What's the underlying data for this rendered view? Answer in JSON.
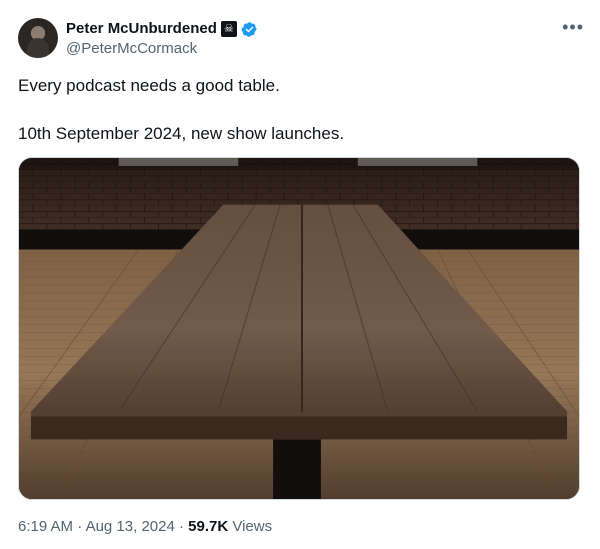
{
  "author": {
    "display_name": "Peter McUnburdened",
    "handle": "@PeterMcCormack",
    "flag_icon": "pirate-flag-icon",
    "verified_icon": "verified-badge-icon",
    "verified_color": "#1d9bf0"
  },
  "tweet": {
    "lines": [
      "Every podcast needs a good table.",
      "10th September 2024, new show launches."
    ]
  },
  "media": {
    "description_icon": "image"
  },
  "meta": {
    "time": "6:19 AM",
    "separator": "·",
    "date": "Aug 13, 2024",
    "views_count": "59.7K",
    "views_label": "Views"
  },
  "more_icon": "more-options-icon"
}
